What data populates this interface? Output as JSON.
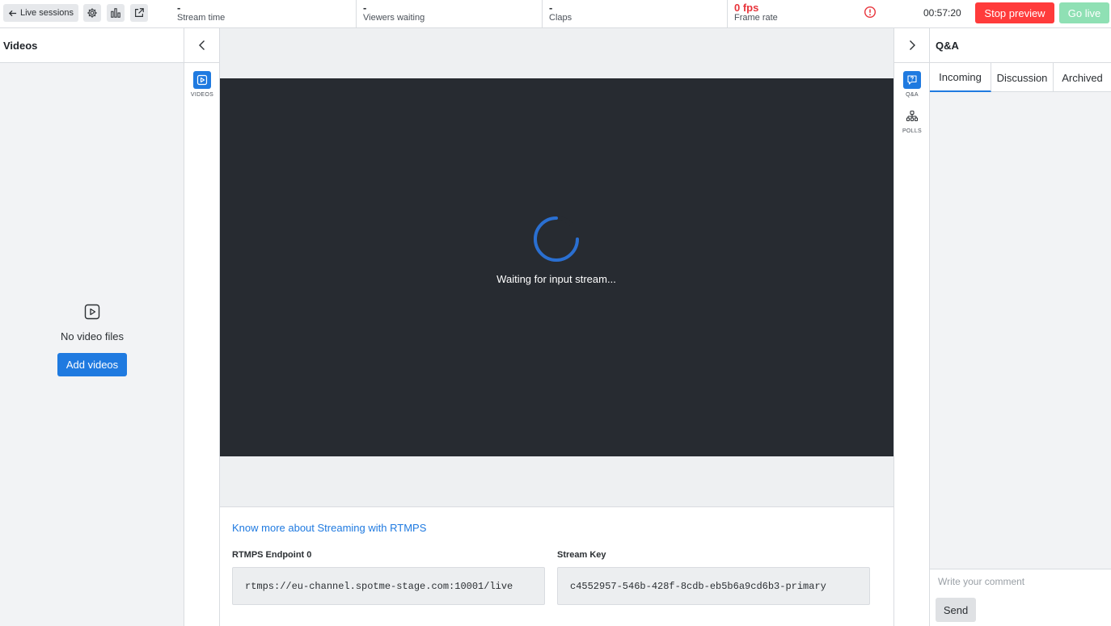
{
  "topbar": {
    "back_label": "Live sessions",
    "stats": [
      {
        "value": "-",
        "label": "Stream time"
      },
      {
        "value": "-",
        "label": "Viewers waiting"
      },
      {
        "value": "-",
        "label": "Claps"
      },
      {
        "value": "0 fps",
        "label": "Frame rate"
      }
    ],
    "clock": "00:57:20",
    "stop_preview": "Stop preview",
    "go_live": "Go live"
  },
  "left_panel": {
    "title": "Videos",
    "empty_text": "No video files",
    "add_button": "Add videos"
  },
  "left_rail": {
    "items": [
      {
        "label": "VIDEOS",
        "icon": "video-file-icon"
      }
    ]
  },
  "player": {
    "waiting_text": "Waiting for input stream..."
  },
  "rtmps": {
    "link_text": "Know more about Streaming with RTMPS",
    "endpoint_label": "RTMPS Endpoint 0",
    "endpoint_value": "rtmps://eu-channel.spotme-stage.com:10001/live",
    "key_label": "Stream Key",
    "key_value": "c4552957-546b-428f-8cdb-eb5b6a9cd6b3-primary"
  },
  "right_rail": {
    "items": [
      {
        "label": "Q&A",
        "icon": "qa-icon"
      },
      {
        "label": "POLLS",
        "icon": "polls-icon"
      }
    ]
  },
  "qa_panel": {
    "title": "Q&A",
    "tabs": [
      {
        "label": "Incoming",
        "active": true
      },
      {
        "label": "Discussion",
        "active": false
      },
      {
        "label": "Archived",
        "active": false
      }
    ],
    "comment_placeholder": "Write your comment",
    "send_label": "Send"
  },
  "colors": {
    "accent": "#1f7ae0",
    "danger": "#ff3b3b",
    "go_live_disabled": "#8fe0b4",
    "player_bg": "#272b31"
  }
}
